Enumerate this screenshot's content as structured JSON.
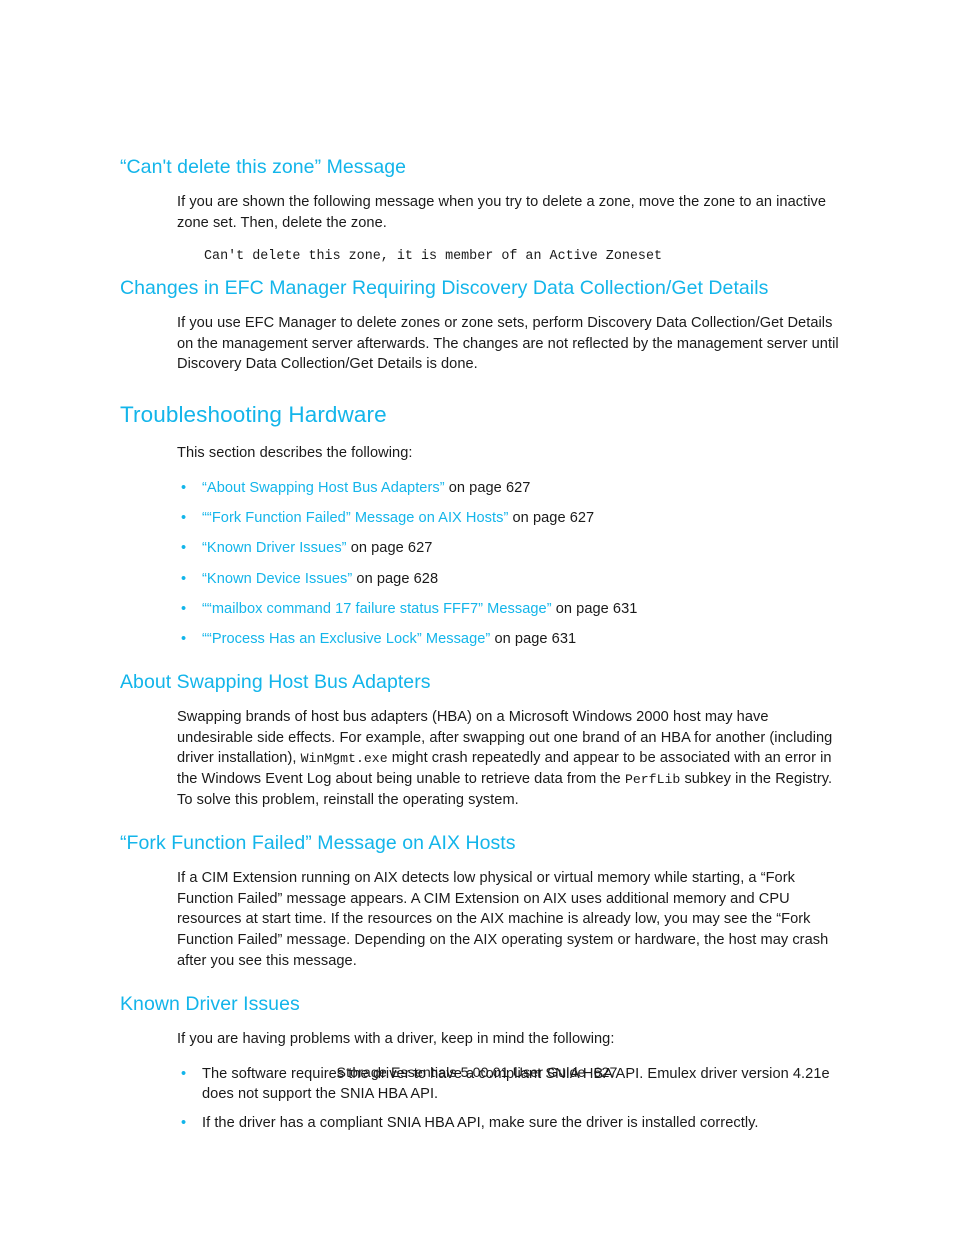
{
  "document": {
    "footer_text": "Storage Essentials 5.00.01 User Guide",
    "page_number": "627",
    "heading_color": "#13b5ea",
    "body_color": "#1a1a1a"
  },
  "sections": {
    "cant_delete_zone": {
      "heading": "“Can't delete this zone” Message",
      "paragraph": "If you are shown the following message when you try to delete a zone, move the zone to an inactive zone set. Then, delete the zone.",
      "code": "Can't delete this zone, it is member of an Active Zoneset"
    },
    "efc_manager_changes": {
      "heading": "Changes in EFC Manager Requiring Discovery Data Collection/Get Details",
      "paragraph": "If you use EFC Manager to delete zones or zone sets, perform Discovery Data Collection/Get Details on the management server afterwards. The changes are not reflected by the management server until Discovery Data Collection/Get Details is done."
    },
    "troubleshooting_hardware": {
      "heading": "Troubleshooting Hardware",
      "intro": "This section describes the following:",
      "links": [
        {
          "label": "“About Swapping Host Bus Adapters”",
          "tail": " on page 627"
        },
        {
          "label": "““Fork Function Failed” Message on AIX Hosts”",
          "tail": " on page 627"
        },
        {
          "label": "“Known Driver Issues”",
          "tail": " on page 627"
        },
        {
          "label": "“Known Device Issues”",
          "tail": " on page 628"
        },
        {
          "label": "““mailbox command 17 failure status FFF7” Message”",
          "tail": " on page 631"
        },
        {
          "label": "““Process Has an Exclusive Lock” Message”",
          "tail": " on page 631"
        }
      ]
    },
    "about_swapping_hba": {
      "heading": "About Swapping Host Bus Adapters",
      "paragraph_part1": "Swapping brands of host bus adapters (HBA) on a Microsoft Windows 2000 host may have undesirable side effects. For example, after swapping out one brand of an HBA for another (including driver installation), ",
      "code_inline_1": "WinMgmt.exe",
      "paragraph_part2": " might crash repeatedly and appear to be associated with an error in the Windows Event Log about being unable to retrieve data from the ",
      "code_inline_2": "PerfLib",
      "paragraph_part3": " subkey in the Registry. To solve this problem, reinstall the operating system."
    },
    "fork_function_failed": {
      "heading": "“Fork Function Failed” Message on AIX Hosts",
      "paragraph": "If a CIM Extension running on AIX detects low physical or virtual memory while starting, a “Fork Function Failed” message appears. A CIM Extension on AIX uses additional memory and CPU resources at start time. If the resources on the AIX machine is already low, you may see the “Fork Function Failed” message. Depending on the AIX operating system or hardware, the host may crash after you see this message."
    },
    "known_driver_issues": {
      "heading": "Known Driver Issues",
      "intro": "If you are having problems with a driver, keep in mind the following:",
      "items": [
        "The software requires the driver to have a compliant SNIA HBA API. Emulex driver version 4.21e does not support the SNIA HBA API.",
        "If the driver has a compliant SNIA HBA API, make sure the driver is installed correctly."
      ]
    }
  }
}
